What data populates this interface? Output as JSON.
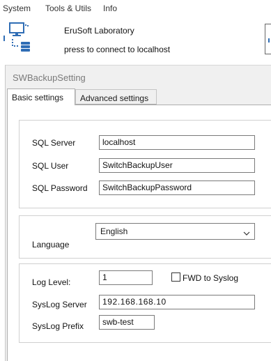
{
  "menu": [
    "System",
    "Tools & Utils",
    "Info"
  ],
  "toolbar": {
    "app_name": "EruSoft Laboratory",
    "connect_status": "press to connect to localhost",
    "icon": "network-database-icon"
  },
  "window": {
    "title": "SWBackupSetting",
    "tabs": [
      "Basic settings",
      "Advanced settings"
    ],
    "active_tab": "Basic settings"
  },
  "sql": {
    "server_label": "SQL Server",
    "server_value": "localhost",
    "user_label": "SQL User",
    "user_value": "SwitchBackupUser",
    "password_label": "SQL Password",
    "password_value": "SwitchBackupPassword"
  },
  "language": {
    "label": "Language",
    "selected": "English"
  },
  "logging": {
    "log_level_label": "Log Level:",
    "log_level_value": "1",
    "fwd_label": "FWD to Syslog",
    "fwd_checked": false,
    "syslog_server_label": "SysLog Server",
    "syslog_server_value": "192.168.168.10",
    "syslog_prefix_label": "SysLog Prefix",
    "syslog_prefix_value": "swb-test"
  },
  "colors": {
    "accent": "#2f6db5",
    "window_bg": "#f0f0f0"
  }
}
